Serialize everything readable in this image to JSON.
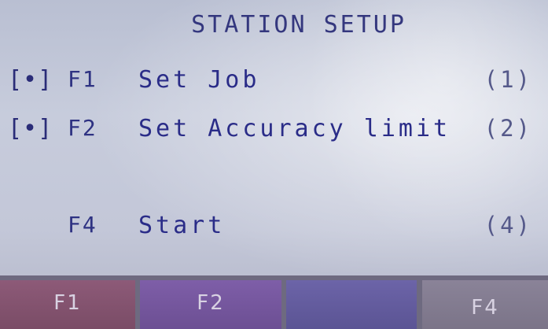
{
  "screen": {
    "title": "STATION SETUP"
  },
  "menu": [
    {
      "marker": "[•]",
      "key": "F1",
      "label": "Set Job",
      "number": "(1)"
    },
    {
      "marker": "[•]",
      "key": "F2",
      "label": "Set Accuracy limit",
      "number": "(2)"
    },
    {
      "marker": "",
      "key": "F4",
      "label": "Start",
      "number": "(4)"
    }
  ],
  "softkeys": [
    {
      "label": "F1",
      "color": "#7a4c66"
    },
    {
      "label": "F2",
      "color": "#6c4f93"
    },
    {
      "label": "",
      "color": "#5b5494"
    },
    {
      "label": "F4",
      "color": "#7b7488"
    }
  ]
}
